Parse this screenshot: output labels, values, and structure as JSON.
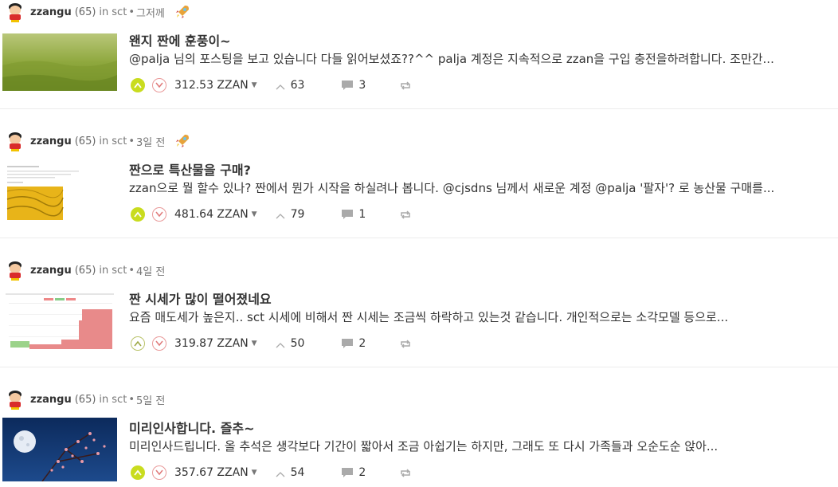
{
  "posts": [
    {
      "author": "zzangu",
      "reputation": "(65)",
      "in_label": "in",
      "category": "sct",
      "separator": "•",
      "time": "그저께",
      "title": "왠지 짠에 훈풍이~",
      "excerpt": "@palja 님의 포스팅을 보고 있습니다 다들 읽어보셨죠??^^ palja 계정은 지속적으로 zzan을 구입 충전을하려합니다. 조만간...",
      "payout": "312.53 ZZAN",
      "votes": "63",
      "comments": "3",
      "upvoted": true,
      "thumbnail": "grass-field",
      "show_rocket": true
    },
    {
      "author": "zzangu",
      "reputation": "(65)",
      "in_label": "in",
      "category": "sct",
      "separator": "•",
      "time": "3일 전",
      "title": "짠으로 특산물을 구매?",
      "excerpt": "zzan으로 뭘 할수 있나? 짠에서 뭔가 시작을 하실려나 봅니다. @cjsdns 님께서 새로운 계정 @palja '팔자'? 로 농산물 구매를...",
      "payout": "481.64 ZZAN",
      "votes": "79",
      "comments": "1",
      "upvoted": true,
      "thumbnail": "rice-field",
      "show_rocket": true
    },
    {
      "author": "zzangu",
      "reputation": "(65)",
      "in_label": "in",
      "category": "sct",
      "separator": "•",
      "time": "4일 전",
      "title": "짠 시세가 많이 떨어졌네요",
      "excerpt": "요즘 매도세가 높은지.. sct 시세에 비해서 짠 시세는 조금씩 하락하고 있는것 같습니다. 개인적으로는 소각모델 등으로...",
      "payout": "319.87 ZZAN",
      "votes": "50",
      "comments": "2",
      "upvoted": false,
      "thumbnail": "price-chart",
      "show_rocket": false
    },
    {
      "author": "zzangu",
      "reputation": "(65)",
      "in_label": "in",
      "category": "sct",
      "separator": "•",
      "time": "5일 전",
      "title": "미리인사합니다. 즐추~",
      "excerpt": "미리인사드립니다. 올 추석은 생각보다 기간이 짧아서 조금 아쉽기는 하지만, 그래도 또 다시 가족들과 오순도순 앉아...",
      "payout": "357.67 ZZAN",
      "votes": "54",
      "comments": "2",
      "upvoted": true,
      "thumbnail": "moon-blossoms",
      "show_rocket": false
    }
  ],
  "colors": {
    "upvote_fill": "#c9dc1f",
    "downvote_border": "#e99a9a",
    "text": "#333333",
    "muted": "#777777",
    "divider": "#ececec"
  }
}
